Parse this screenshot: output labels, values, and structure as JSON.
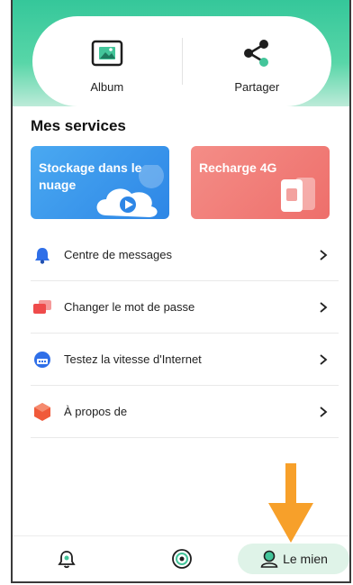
{
  "actions": {
    "album": {
      "label": "Album",
      "icon": "image-album-icon"
    },
    "share": {
      "label": "Partager",
      "icon": "share-icon"
    }
  },
  "services": {
    "title": "Mes services",
    "tiles": [
      {
        "label": "Stockage dans le nuage",
        "icon": "cloud-play-icon",
        "color": "#3f9cee"
      },
      {
        "label": "Recharge 4G",
        "icon": "sim-card-icon",
        "color": "#f07d79"
      }
    ]
  },
  "menu": [
    {
      "label": "Centre de messages",
      "icon": "bell-icon",
      "color": "#2f6fe8"
    },
    {
      "label": "Changer le mot de passe",
      "icon": "password-cards-icon",
      "color": "#ef4b4b"
    },
    {
      "label": "Testez la vitesse d'Internet",
      "icon": "speedometer-icon",
      "color": "#2f6fe8"
    },
    {
      "label": "À propos de",
      "icon": "hexagon-info-icon",
      "color": "#f05a3a"
    }
  ],
  "nav": {
    "alerts_icon": "bell-nav-icon",
    "camera_icon": "target-camera-icon",
    "me_label": "Le mien",
    "me_icon": "profile-icon",
    "accent": "#dff3e8"
  },
  "annotation": {
    "arrow_color": "#f7a02a"
  }
}
